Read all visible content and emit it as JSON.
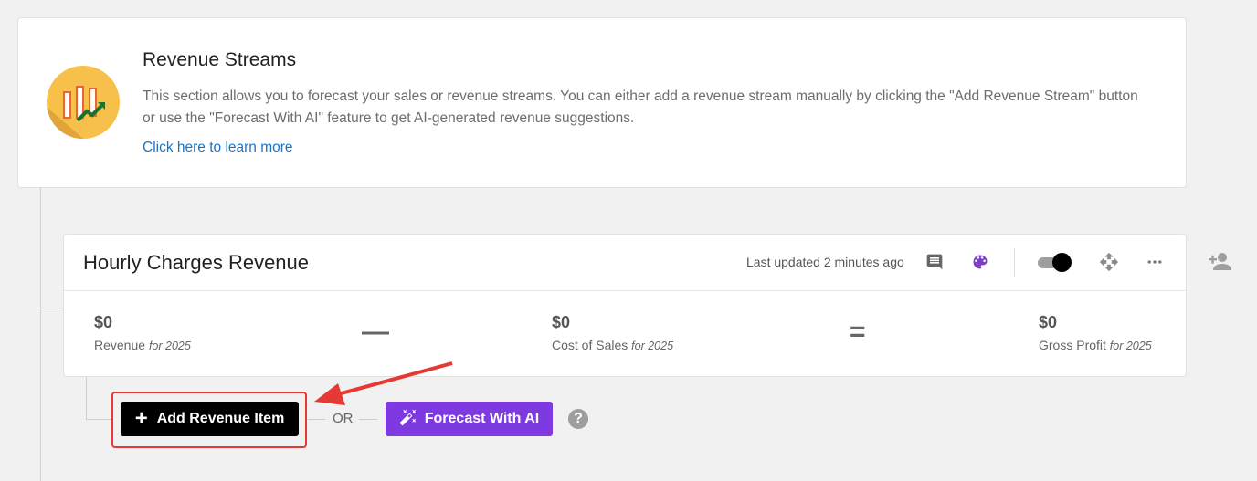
{
  "intro": {
    "title": "Revenue Streams",
    "description": "This section allows you to forecast your sales or revenue streams. You can either add a revenue stream manually by clicking the \"Add Revenue Stream\" button or use the \"Forecast With AI\" feature to get AI-generated revenue suggestions.",
    "learn_more": "Click here to learn more",
    "logo_icon": "revenue-chart-logo"
  },
  "stream": {
    "title": "Hourly Charges Revenue",
    "last_updated": "Last updated 2 minutes ago",
    "icons": [
      "comment-icon",
      "palette-icon",
      "toggle",
      "move-icon",
      "more-icon"
    ],
    "toggle_on": true,
    "metrics": [
      {
        "value": "$0",
        "label": "Revenue",
        "period": "for 2025"
      },
      {
        "value": "$0",
        "label": "Cost of Sales",
        "period": "for 2025"
      },
      {
        "value": "$0",
        "label": "Gross Profit",
        "period": "for 2025"
      }
    ],
    "operators": [
      "—",
      "="
    ]
  },
  "actions": {
    "add_label": "Add Revenue Item",
    "or_label": "OR",
    "ai_label": "Forecast With AI",
    "help_label": "?"
  },
  "colors": {
    "ai_button": "#7e3ae0",
    "highlight": "#e53935",
    "link": "#1a73c8",
    "palette_icon": "#7b3fc4"
  }
}
